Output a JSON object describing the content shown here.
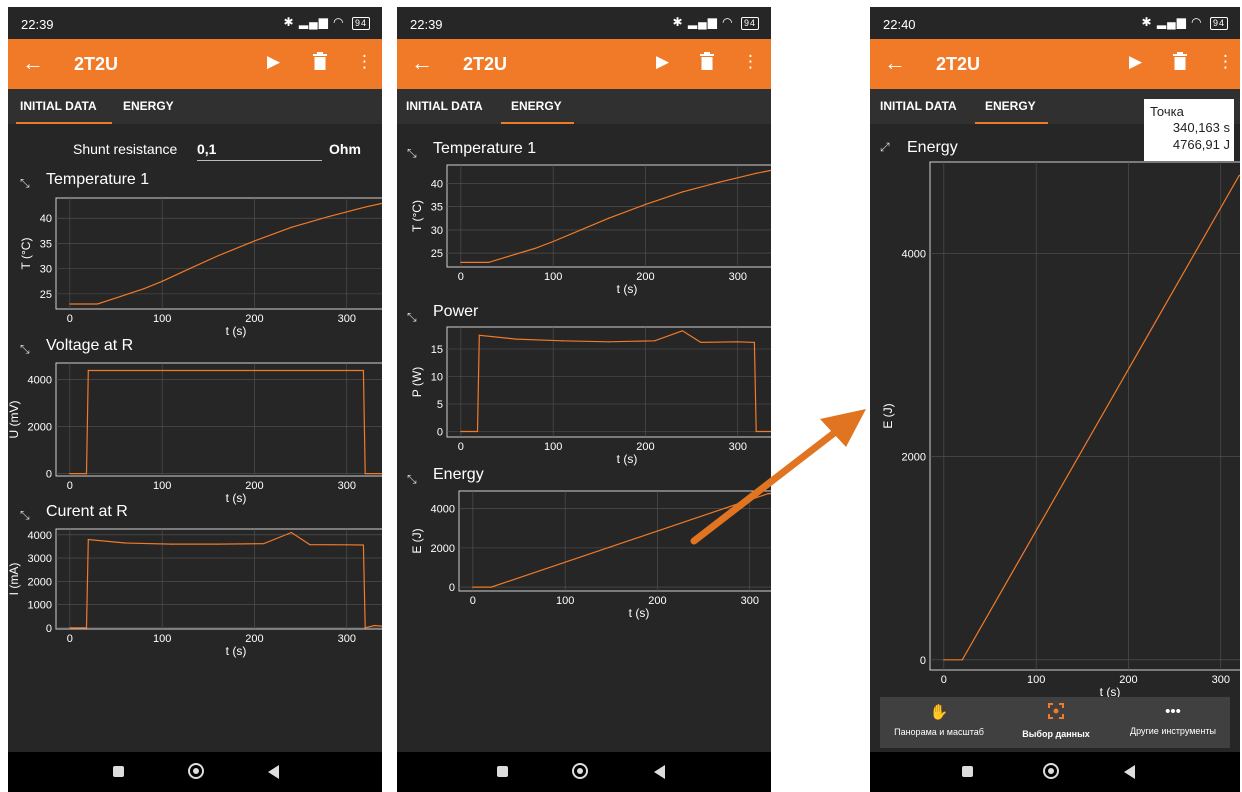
{
  "screens": [
    {
      "time": "22:39",
      "battery": "94",
      "title": "2T2U",
      "tabs": [
        "INITIAL DATA",
        "ENERGY"
      ],
      "active_tab": 0,
      "shunt": {
        "label": "Shunt resistance",
        "value": "0,1",
        "unit": "Ohm"
      },
      "charts": [
        {
          "title": "Temperature 1",
          "xlabel": "t (s)",
          "ylabel": "T (°C)"
        },
        {
          "title": "Voltage at R",
          "xlabel": "t (s)",
          "ylabel": "U (mV)"
        },
        {
          "title": "Curent at R",
          "xlabel": "t (s)",
          "ylabel": "I (mA)"
        }
      ]
    },
    {
      "time": "22:39",
      "battery": "94",
      "title": "2T2U",
      "tabs": [
        "INITIAL DATA",
        "ENERGY"
      ],
      "active_tab": 1,
      "charts": [
        {
          "title": "Temperature 1",
          "xlabel": "t (s)",
          "ylabel": "T (°C)"
        },
        {
          "title": "Power",
          "xlabel": "t (s)",
          "ylabel": "P (W)"
        },
        {
          "title": "Energy",
          "xlabel": "t (s)",
          "ylabel": "E (J)"
        }
      ]
    },
    {
      "time": "22:40",
      "battery": "94",
      "title": "2T2U",
      "tabs": [
        "INITIAL DATA",
        "ENERGY"
      ],
      "active_tab": 1,
      "charts": [
        {
          "title": "Energy",
          "xlabel": "t (s)",
          "ylabel": "E (J)"
        }
      ],
      "tooltip": {
        "title": "Точка",
        "x": "340,163 s",
        "y": "4766,91 J"
      },
      "toolbar": [
        {
          "icon": "hand-icon",
          "label": "Панорама и масштаб",
          "active": false
        },
        {
          "icon": "select-data-icon",
          "label": "Выбор данных",
          "active": true
        },
        {
          "icon": "more-icon",
          "label": "Другие инструменты",
          "active": false
        }
      ]
    }
  ],
  "colors": {
    "accent": "#f07a27",
    "background": "#262626",
    "line": "#f07a27"
  },
  "chart_data": [
    {
      "id": "temperature",
      "type": "line",
      "title": "Temperature 1",
      "xlabel": "t (s)",
      "ylabel": "T (°C)",
      "xlim": [
        -15,
        375
      ],
      "ylim": [
        22,
        44
      ],
      "xticks": [
        0,
        100,
        200,
        300
      ],
      "yticks": [
        25,
        30,
        35,
        40
      ],
      "x": [
        0,
        30,
        50,
        80,
        100,
        130,
        160,
        200,
        240,
        280,
        320,
        340,
        355
      ],
      "y": [
        23,
        23,
        24.2,
        26,
        27.5,
        30,
        32.5,
        35.5,
        38.2,
        40.3,
        42.2,
        43,
        42.7
      ]
    },
    {
      "id": "voltage",
      "type": "line",
      "title": "Voltage at R",
      "xlabel": "t (s)",
      "ylabel": "U (mV)",
      "xlim": [
        -15,
        375
      ],
      "ylim": [
        -100,
        4700
      ],
      "xticks": [
        0,
        100,
        200,
        300
      ],
      "yticks": [
        0,
        2000,
        4000
      ],
      "x": [
        0,
        18,
        20,
        318,
        320,
        345
      ],
      "y": [
        0,
        0,
        4380,
        4380,
        0,
        0
      ]
    },
    {
      "id": "current",
      "type": "line",
      "title": "Curent at R",
      "xlabel": "t (s)",
      "ylabel": "I (mA)",
      "xlim": [
        -15,
        375
      ],
      "ylim": [
        -50,
        4250
      ],
      "xticks": [
        0,
        100,
        200,
        300
      ],
      "yticks": [
        0,
        1000,
        2000,
        3000,
        4000
      ],
      "x": [
        0,
        18,
        20,
        60,
        110,
        160,
        210,
        240,
        260,
        300,
        318,
        320,
        330,
        345,
        350
      ],
      "y": [
        0,
        0,
        3800,
        3650,
        3600,
        3600,
        3620,
        4100,
        3580,
        3570,
        3560,
        0,
        100,
        50,
        0
      ]
    },
    {
      "id": "power",
      "type": "line",
      "title": "Power",
      "xlabel": "t (s)",
      "ylabel": "P (W)",
      "xlim": [
        -15,
        375
      ],
      "ylim": [
        -1,
        19
      ],
      "xticks": [
        0,
        100,
        200,
        300
      ],
      "yticks": [
        0,
        5,
        10,
        15
      ],
      "x": [
        0,
        18,
        20,
        60,
        110,
        160,
        210,
        240,
        260,
        300,
        318,
        320,
        345,
        370
      ],
      "y": [
        0,
        0,
        17.5,
        16.8,
        16.5,
        16.3,
        16.5,
        18.3,
        16.2,
        16.3,
        16.2,
        0,
        0,
        0
      ]
    },
    {
      "id": "energy",
      "type": "line",
      "title": "Energy",
      "xlabel": "t (s)",
      "ylabel": "E (J)",
      "xlim": [
        -15,
        375
      ],
      "ylim": [
        -200,
        4900
      ],
      "xticks": [
        0,
        100,
        200,
        300
      ],
      "yticks": [
        0,
        2000,
        4000
      ],
      "x": [
        0,
        20,
        320,
        370
      ],
      "y": [
        0,
        0,
        4767,
        4767
      ]
    },
    {
      "id": "energy-detail",
      "type": "line",
      "title": "Energy",
      "xlabel": "t (s)",
      "ylabel": "E (J)",
      "xlim": [
        -15,
        375
      ],
      "ylim": [
        -100,
        4900
      ],
      "xticks": [
        0,
        100,
        200,
        300
      ],
      "yticks": [
        0,
        2000,
        4000
      ],
      "x": [
        0,
        20,
        320,
        370
      ],
      "y": [
        0,
        0,
        4767,
        4767
      ],
      "selected_point": {
        "x": 340.163,
        "y": 4766.91
      }
    }
  ]
}
